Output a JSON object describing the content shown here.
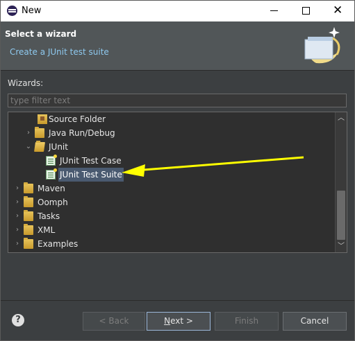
{
  "window": {
    "title": "New"
  },
  "banner": {
    "title": "Select a wizard",
    "description": "Create a JUnit test suite"
  },
  "wizards_label": "Wizards:",
  "filter": {
    "placeholder": "type filter text",
    "value": ""
  },
  "tree": {
    "items": [
      {
        "label": "Source Folder",
        "level": 2,
        "expander": "none",
        "icon": "source-folder-icon"
      },
      {
        "label": "Java Run/Debug",
        "level": 1,
        "expander": "collapsed",
        "icon": "folder-icon"
      },
      {
        "label": "JUnit",
        "level": 1,
        "expander": "expanded",
        "icon": "folder-open-icon"
      },
      {
        "label": "JUnit Test Case",
        "level": 2,
        "expander": "none",
        "icon": "junit-test-case-icon"
      },
      {
        "label": "JUnit Test Suite",
        "level": 2,
        "expander": "none",
        "icon": "junit-test-suite-icon",
        "selected": true
      },
      {
        "label": "Maven",
        "level": 0,
        "expander": "collapsed",
        "icon": "folder-icon"
      },
      {
        "label": "Oomph",
        "level": 0,
        "expander": "collapsed",
        "icon": "folder-icon"
      },
      {
        "label": "Tasks",
        "level": 0,
        "expander": "collapsed",
        "icon": "folder-icon"
      },
      {
        "label": "XML",
        "level": 0,
        "expander": "collapsed",
        "icon": "folder-icon"
      },
      {
        "label": "Examples",
        "level": 0,
        "expander": "collapsed",
        "icon": "folder-icon"
      }
    ]
  },
  "buttons": {
    "back": "< Back",
    "next_mnemonic": "N",
    "next_rest": "ext >",
    "finish": "Finish",
    "cancel": "Cancel",
    "help": "?"
  },
  "colors": {
    "background": "#3c3f41",
    "banner": "#515658",
    "link": "#8ec9ef",
    "selection": "#4a5a70",
    "annotation_arrow": "#ffff00"
  }
}
